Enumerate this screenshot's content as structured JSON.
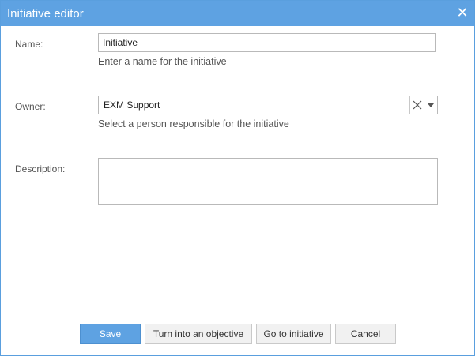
{
  "dialog": {
    "title": "Initiative editor",
    "close_label": "✕"
  },
  "form": {
    "name": {
      "label": "Name:",
      "value": "Initiative",
      "hint": "Enter a name for the initiative"
    },
    "owner": {
      "label": "Owner:",
      "value": "EXM Support",
      "hint": "Select a person responsible for the initiative"
    },
    "description": {
      "label": "Description:",
      "value": ""
    }
  },
  "buttons": {
    "save": "Save",
    "turn_into_objective": "Turn into an objective",
    "go_to_initiative": "Go to initiative",
    "cancel": "Cancel"
  },
  "icons": {
    "close": "close-icon",
    "clear": "clear-icon",
    "dropdown": "chevron-down-icon"
  },
  "colors": {
    "accent": "#5ea2e2",
    "border": "#b9b9b9",
    "label_text": "#555555"
  }
}
